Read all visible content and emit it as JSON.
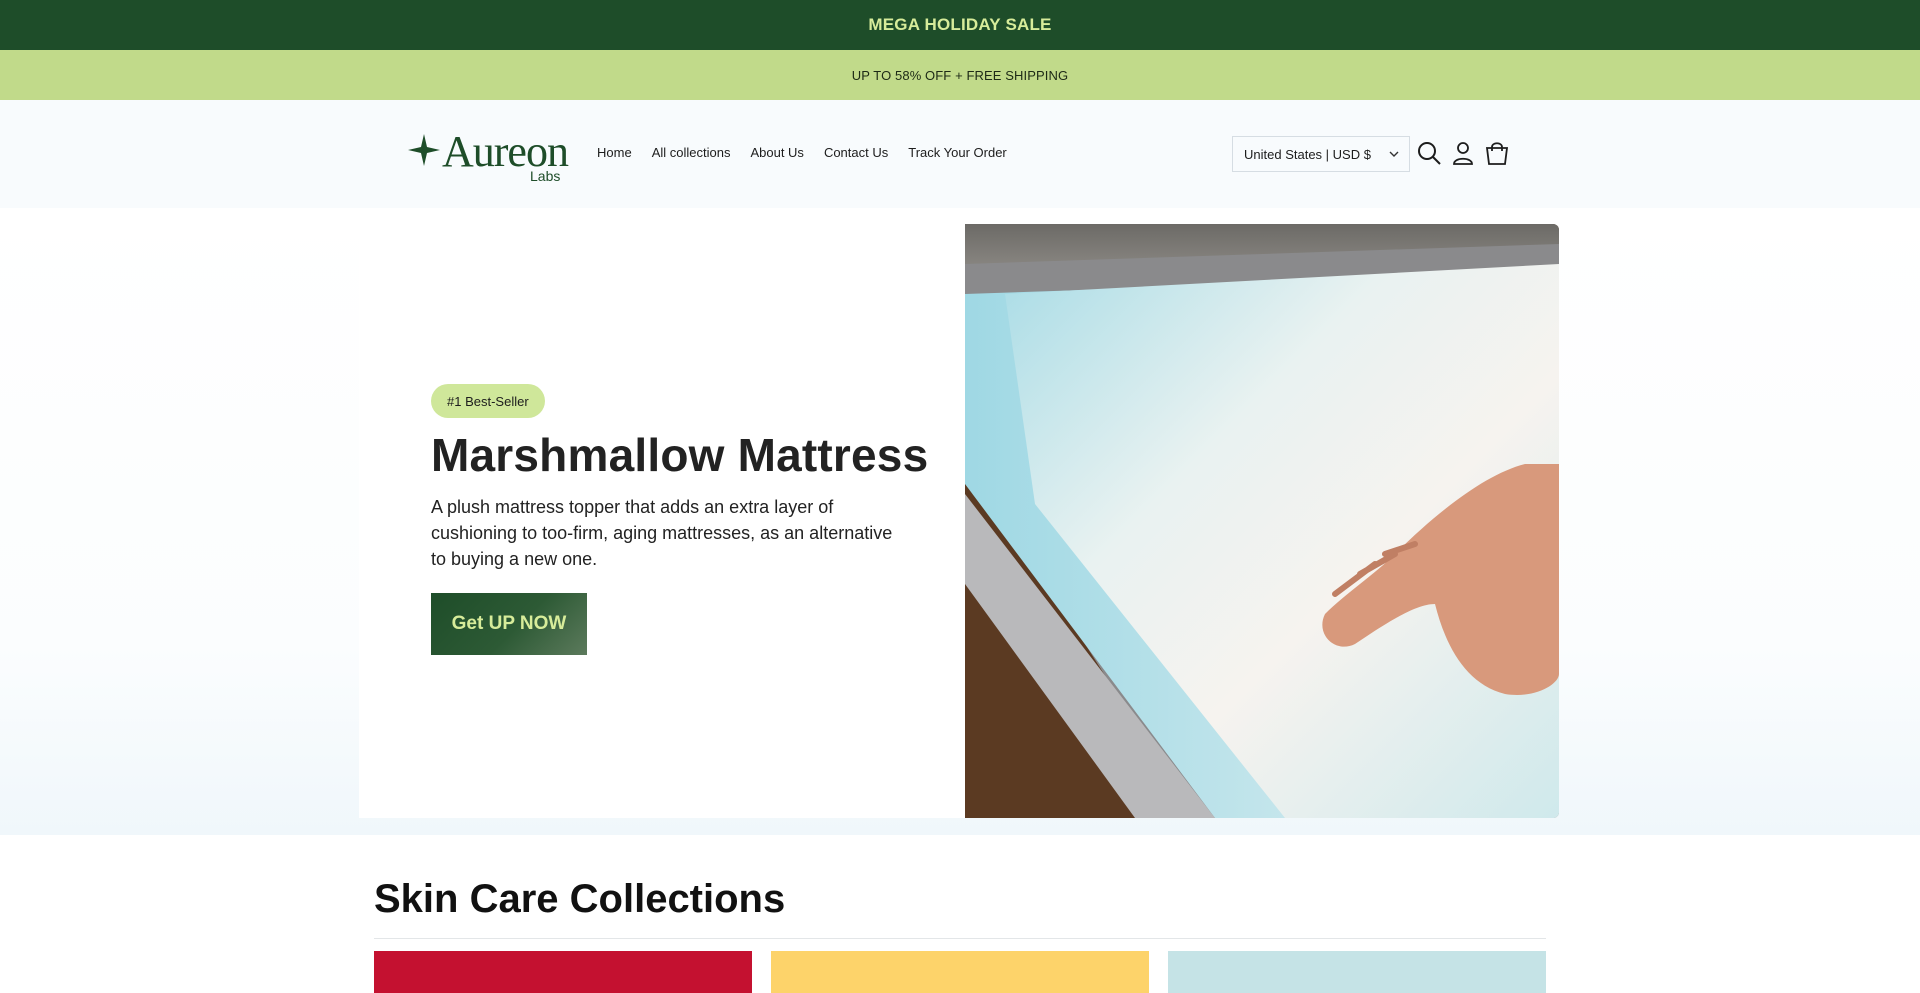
{
  "announcement": {
    "primary": "MEGA HOLIDAY SALE",
    "secondary": "UP TO 58% OFF + FREE SHIPPING"
  },
  "header": {
    "logo": {
      "word": "Aureon",
      "sub": "Labs"
    },
    "nav": [
      "Home",
      "All collections",
      "About Us",
      "Contact Us",
      "Track Your Order"
    ],
    "country_selector": "United States | USD $",
    "icons": [
      "search-icon",
      "account-icon",
      "cart-icon"
    ]
  },
  "hero": {
    "badge": "#1 Best-Seller",
    "title": "Marshmallow Mattress",
    "description": "A plush mattress topper that adds an extra layer of cushioning to too-firm, aging mattresses, as an alternative to buying a new one.",
    "cta": "Get UP NOW"
  },
  "collections": {
    "title": "Skin Care Collections",
    "cards": [
      {
        "color": "#c41130"
      },
      {
        "color": "#fdd36a"
      },
      {
        "color": "#c5e3e6"
      }
    ]
  },
  "colors": {
    "brand_dark": "#1e4d29",
    "brand_light": "#c1da8a",
    "accent_text": "#d7ec9a",
    "badge": "#cfe79a"
  }
}
